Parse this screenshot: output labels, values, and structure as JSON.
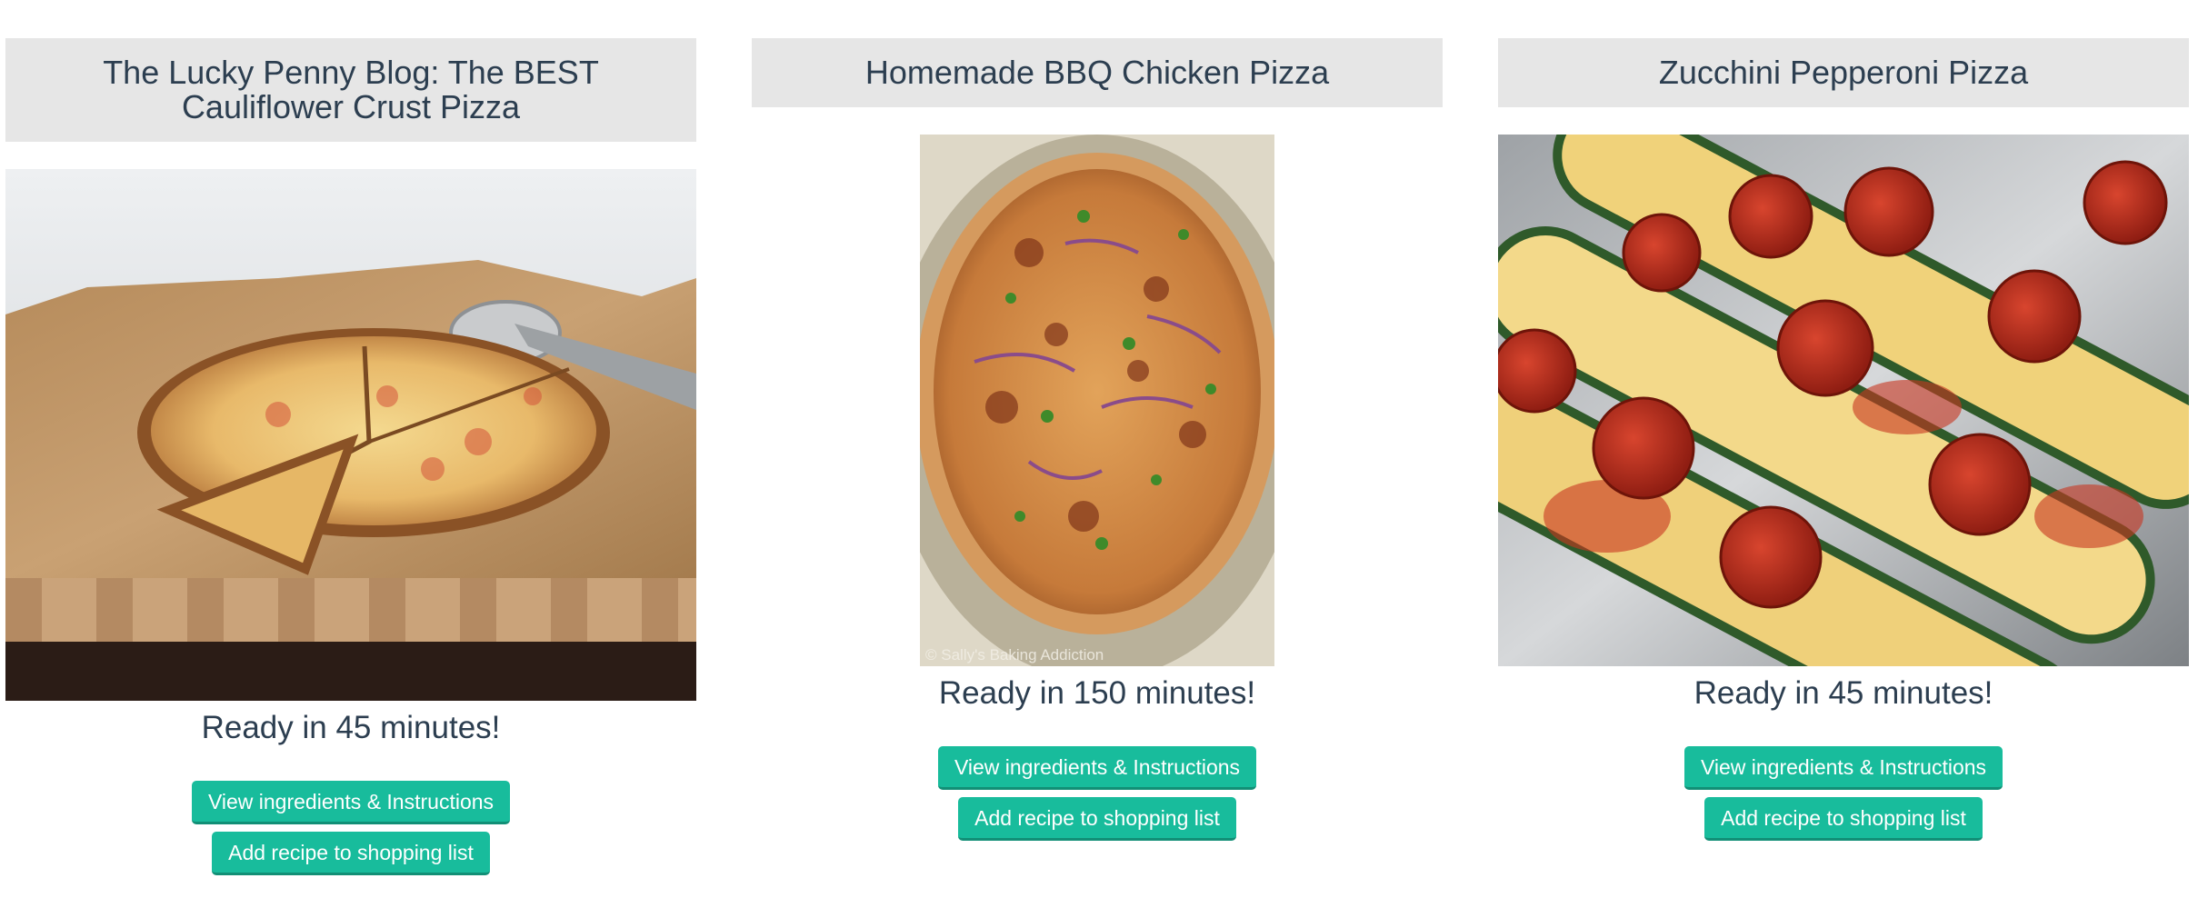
{
  "recipes": [
    {
      "title": "The Lucky Penny Blog: The BEST Cauliflower Crust Pizza",
      "ready": "Ready in 45 minutes!",
      "view_label": "View ingredients & Instructions",
      "add_label": "Add recipe to shopping list"
    },
    {
      "title": "Homemade BBQ Chicken Pizza",
      "ready": "Ready in 150 minutes!",
      "view_label": "View ingredients & Instructions",
      "add_label": "Add recipe to shopping list",
      "photo_watermark": "© Sally's Baking Addiction"
    },
    {
      "title": "Zucchini Pepperoni Pizza",
      "ready": "Ready in 45 minutes!",
      "view_label": "View ingredients & Instructions",
      "add_label": "Add recipe to shopping list"
    }
  ],
  "colors": {
    "title_bg": "#e6e6e6",
    "title_text": "#2c3e50",
    "button_bg": "#18bc9c",
    "button_text": "#ffffff"
  }
}
